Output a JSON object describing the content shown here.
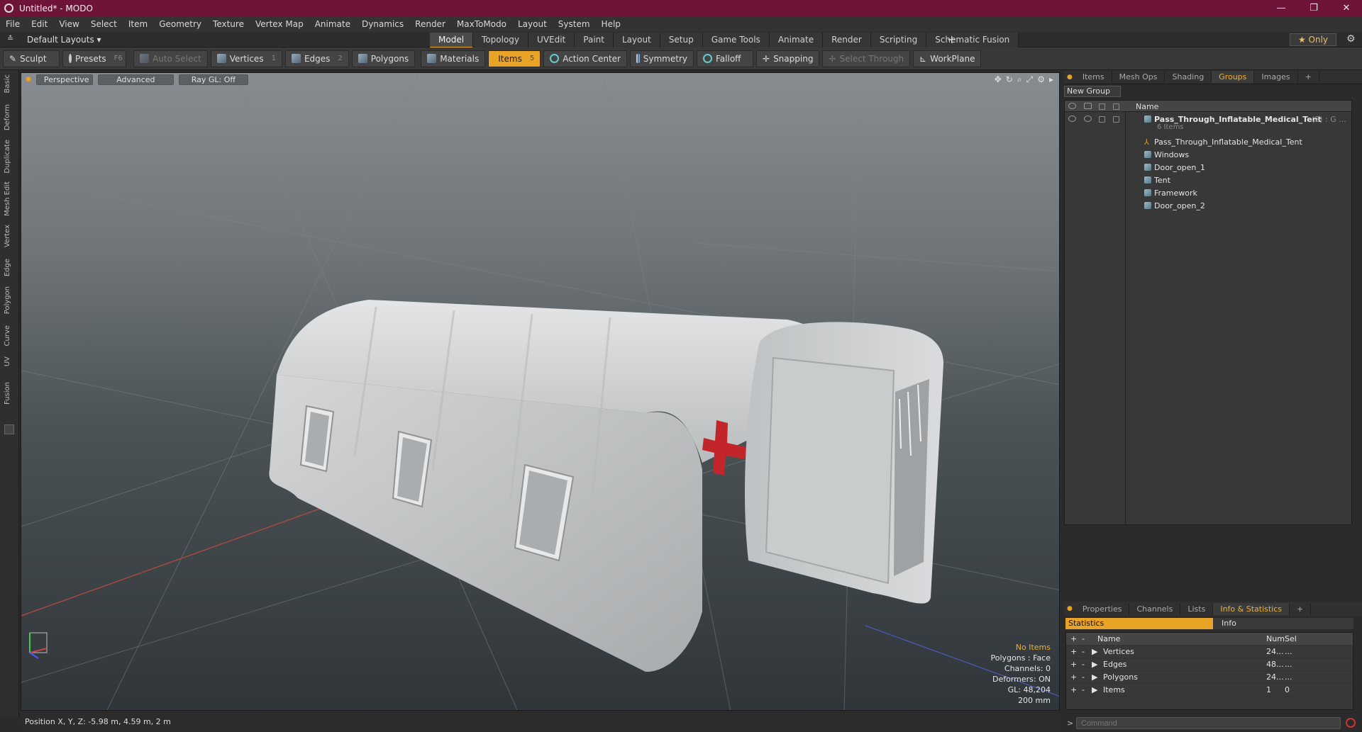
{
  "window": {
    "title": "Untitled* - MODO",
    "min": "—",
    "max": "❐",
    "close": "✕"
  },
  "menu": [
    "File",
    "Edit",
    "View",
    "Select",
    "Item",
    "Geometry",
    "Texture",
    "Vertex Map",
    "Animate",
    "Dynamics",
    "Render",
    "MaxToModo",
    "Layout",
    "System",
    "Help"
  ],
  "layoutbar": {
    "layout_name": "Default Layouts ▾",
    "only": "★  Only",
    "tabs": [
      "Model",
      "Topology",
      "UVEdit",
      "Paint",
      "Layout",
      "Setup",
      "Game Tools",
      "Animate",
      "Render",
      "Scripting",
      "Schematic Fusion"
    ],
    "active_tab": "Model"
  },
  "toolbar": {
    "sculpt": "Sculpt",
    "presets": "Presets",
    "presets_key": "F6",
    "auto_select": "Auto Select",
    "vertices": "Vertices",
    "vertices_count": "1",
    "edges": "Edges",
    "edges_count": "2",
    "polygons": "Polygons",
    "materials": "Materials",
    "items": "Items",
    "items_count": "5",
    "action_center": "Action Center",
    "symmetry": "Symmetry",
    "falloff": "Falloff",
    "snapping": "Snapping",
    "select_through": "Select Through",
    "workplane": "WorkPlane"
  },
  "left_tabs": [
    "Basic",
    "Deform",
    "Duplicate",
    "Mesh Edit",
    "Vertex",
    "Edge",
    "Polygon",
    "Curve",
    "UV",
    "Fusion"
  ],
  "viewport": {
    "perspective": "Perspective",
    "advanced": "Advanced",
    "raygl": "Ray GL: Off",
    "stats": {
      "no_items": "No Items",
      "polygons": "Polygons : Face",
      "channels": "Channels: 0",
      "deformers": "Deformers: ON",
      "gl": "GL: 48,204",
      "scale": "200 mm"
    }
  },
  "statusbar": {
    "position": "Position X, Y, Z:  -5.98 m, 4.59 m, 2 m"
  },
  "groups_panel": {
    "tabs": [
      "Items",
      "Mesh Ops",
      "Shading",
      "Groups",
      "Images",
      "+"
    ],
    "active_tab": "Groups",
    "new_group": "New Group",
    "name_header": "Name",
    "root": {
      "label": "Pass_Through_Inflatable_Medical_Tent",
      "count": "(2) : G ...",
      "sub": "6 Items"
    },
    "children": [
      "Pass_Through_Inflatable_Medical_Tent",
      "Windows",
      "Door_open_1",
      "Tent",
      "Framework",
      "Door_open_2"
    ]
  },
  "stats_panel": {
    "tabs": [
      "Properties",
      "Channels",
      "Lists",
      "Info & Statistics",
      "+"
    ],
    "active_tab": "Info & Statistics",
    "statistics": "Statistics",
    "info": "Info",
    "head": {
      "name": "Name",
      "num": "Num",
      "sel": "Sel"
    },
    "rows": [
      {
        "name": "Vertices",
        "num": "24...",
        "sel": "..."
      },
      {
        "name": "Edges",
        "num": "48...",
        "sel": "..."
      },
      {
        "name": "Polygons",
        "num": "24...",
        "sel": "..."
      },
      {
        "name": "Items",
        "num": "1",
        "sel": "0"
      }
    ]
  },
  "command": {
    "placeholder": "Command"
  }
}
